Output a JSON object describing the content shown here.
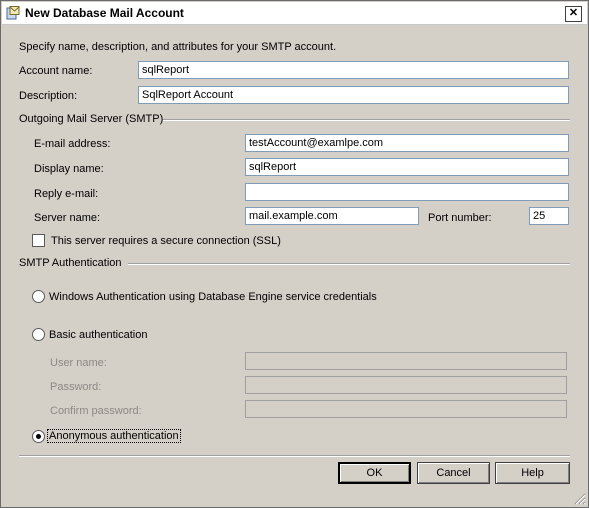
{
  "window": {
    "title": "New Database Mail Account"
  },
  "intro": "Specify name, description, and attributes for your SMTP account.",
  "account": {
    "name_label": "Account name:",
    "name_value": "sqlReport",
    "description_label": "Description:",
    "description_value": "SqlReport Account"
  },
  "smtp": {
    "group_title": "Outgoing Mail Server (SMTP)",
    "email_label": "E-mail address:",
    "email_value": "testAccount@examlpe.com",
    "display_label": "Display name:",
    "display_value": "sqlReport",
    "reply_label": "Reply e-mail:",
    "reply_value": "",
    "server_label": "Server name:",
    "server_value": "mail.example.com",
    "port_label": "Port number:",
    "port_value": "25",
    "ssl_label": "This server requires a secure connection (SSL)",
    "ssl_checked": false
  },
  "auth": {
    "group_title": "SMTP Authentication",
    "windows_label": "Windows Authentication using Database Engine service credentials",
    "basic_label": "Basic authentication",
    "username_label": "User name:",
    "password_label": "Password:",
    "confirm_label": "Confirm password:",
    "anonymous_label": "Anonymous authentication",
    "selected": "anonymous"
  },
  "buttons": {
    "ok": "OK",
    "cancel": "Cancel",
    "help": "Help"
  },
  "icons": {
    "title": "database-mail-icon",
    "close": "close-icon",
    "grip": "resize-grip-icon"
  }
}
